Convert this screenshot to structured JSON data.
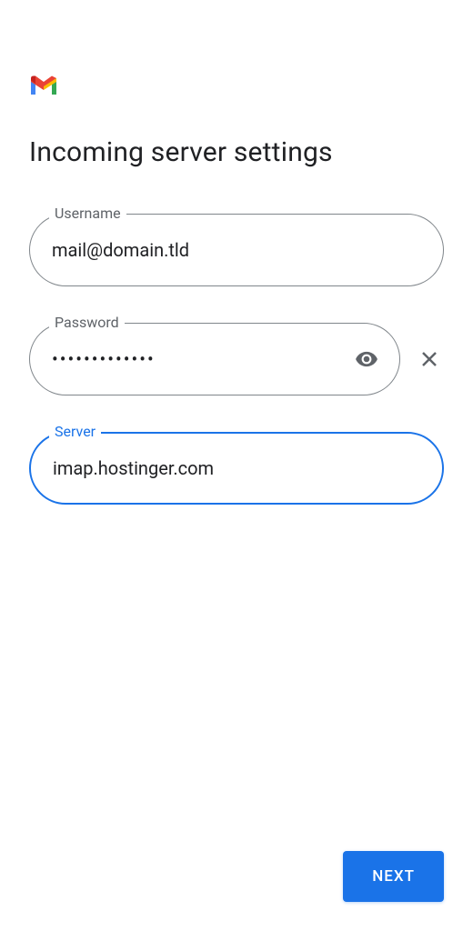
{
  "title": "Incoming server settings",
  "fields": {
    "username": {
      "label": "Username",
      "value": "mail@domain.tld"
    },
    "password": {
      "label": "Password",
      "value": "•••••••••••••"
    },
    "server": {
      "label": "Server",
      "value": "imap.hostinger.com"
    }
  },
  "buttons": {
    "next": "NEXT"
  }
}
